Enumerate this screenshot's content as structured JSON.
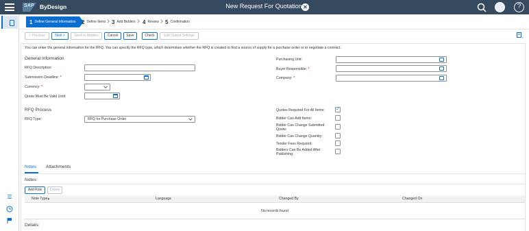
{
  "shell": {
    "app_name": "ByDesign",
    "logo_text": "SAP",
    "title": "New Request For Quotation",
    "close_glyph": "✕",
    "help_glyph": "?"
  },
  "wizard": {
    "steps": [
      {
        "num": "1",
        "label": "Define General Information"
      },
      {
        "num": "2",
        "label": "Define Items"
      },
      {
        "num": "3",
        "label": "Add Bidders"
      },
      {
        "num": "4",
        "label": "Review"
      },
      {
        "num": "5",
        "label": "Confirmation"
      }
    ]
  },
  "toolbar": {
    "previous": "< Previous",
    "next": "Next >",
    "send": "Send to Bidders",
    "cancel": "Cancel",
    "save": "Save",
    "check": "Check",
    "edit_output": "Edit Output Settings"
  },
  "info_text": "You can enter the general information for the RFQ. You can specify the RFQ type, which determines whether the RFQ is created to find a source of supply for a purchase order or to negotiate a contract.",
  "general": {
    "title": "General Information",
    "rfq_description": "RFQ Description:",
    "submission_deadline": "Submission Deadline:",
    "currency": "Currency:",
    "quote_valid_until": "Quote Must Be Valid Until:",
    "purchasing_unit": "Purchasing Unit:",
    "buyer_responsible": "Buyer Responsible:",
    "company": "Company:",
    "required_mark": "*"
  },
  "process": {
    "title": "RFQ Process",
    "rfq_type_label": "RFQ Type:",
    "rfq_type_value": "RFQ for Purchase Order",
    "quotes_required": "Quotes Required For All Items:",
    "bidder_add_items": "Bidder Can Add Items:",
    "bidder_change_quote": "Bidder Can Change Submitted Quote:",
    "bidder_change_qty": "Bidder Can Change Quantity:",
    "tender_fees": "Tender Fees Required:",
    "bidders_after_publish": "Bidders Can Be Added After Publishing:",
    "checked_glyph": "✓"
  },
  "tabs": {
    "notes": "Notes",
    "attachments": "Attachments"
  },
  "notes": {
    "title": "Notes",
    "add_row": "Add Row",
    "delete": "Delete",
    "columns": [
      "Note Type",
      "Language",
      "Changed By",
      "Changed On"
    ],
    "sort_glyph": "▴",
    "empty": "No records found"
  },
  "details": "Details:",
  "colors": {
    "shell_bg": "#354a5f",
    "accent": "#0a6ed1",
    "required": "#bb0000"
  },
  "icons": [
    "menu-icon",
    "search-icon",
    "user-avatar-icon",
    "help-icon",
    "close-icon",
    "document-icon",
    "list-icon",
    "clock-icon",
    "flag-icon",
    "value-help-icon",
    "calendar-icon",
    "chevron-down-icon",
    "layout-settings-icon"
  ]
}
